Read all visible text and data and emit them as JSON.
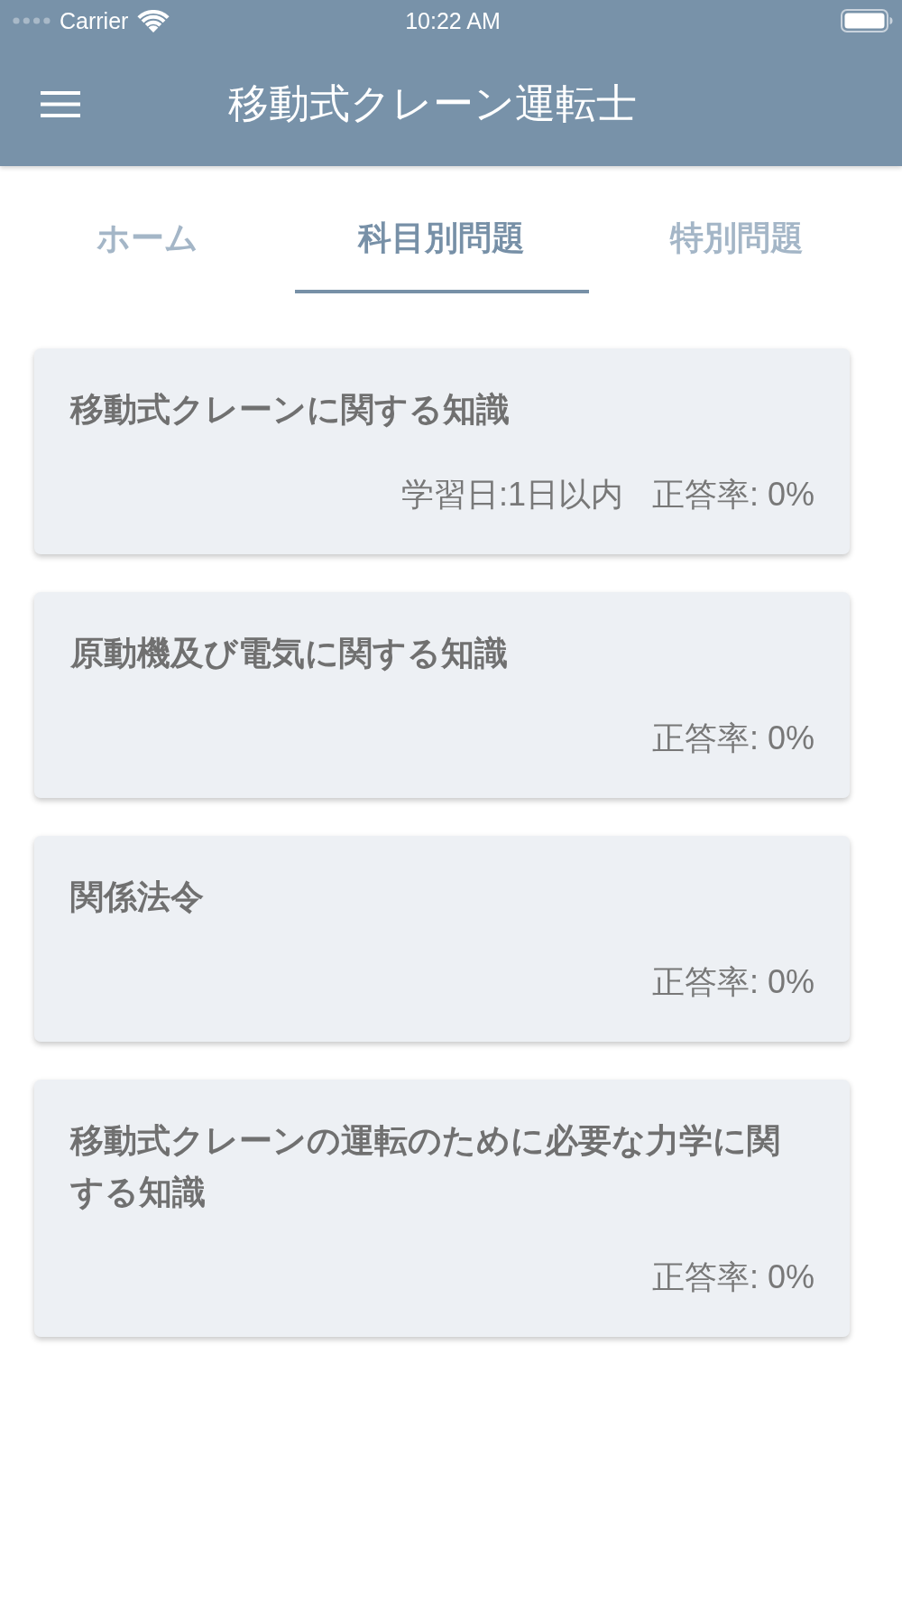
{
  "status_bar": {
    "carrier": "Carrier",
    "time": "10:22 AM"
  },
  "header": {
    "title": "移動式クレーン運転士"
  },
  "tabs": [
    {
      "label": "ホーム",
      "selected": false
    },
    {
      "label": "科目別問題",
      "selected": true
    },
    {
      "label": "特別問題",
      "selected": false
    }
  ],
  "subjects": [
    {
      "title": "移動式クレーンに関する知識",
      "study_date": "学習日:1日以内",
      "accuracy": "正答率: 0%"
    },
    {
      "title": "原動機及び電気に関する知識",
      "accuracy": "正答率: 0%"
    },
    {
      "title": "関係法令",
      "accuracy": "正答率: 0%"
    },
    {
      "title": "移動式クレーンの運転のために必要な力学に関する知識",
      "accuracy": "正答率: 0%"
    }
  ]
}
